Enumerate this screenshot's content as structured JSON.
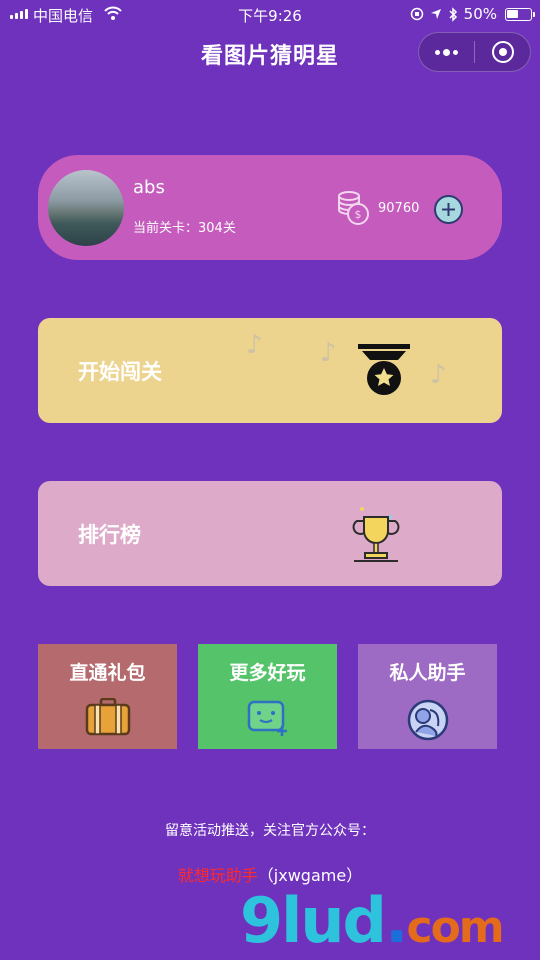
{
  "status_bar": {
    "carrier": "中国电信",
    "time": "下午9:26",
    "battery": "50%"
  },
  "header": {
    "title": "看图片猜明星"
  },
  "profile": {
    "username": "abs",
    "level": "当前关卡：304关",
    "coins": "90760"
  },
  "menu": {
    "start": "开始闯关",
    "rank": "排行榜",
    "tiles": [
      "直通礼包",
      "更多好玩",
      "私人助手"
    ]
  },
  "footer": {
    "notice": "留意活动推送，关注官方公众号：",
    "account_name": "就想玩助手",
    "account_id": "（jxwgame）"
  },
  "watermark": {
    "main": "9lud",
    "dot": ".",
    "com": "com"
  },
  "icons": {
    "status": [
      "signal-icon",
      "wifi-icon",
      "orientation-lock-icon",
      "location-icon",
      "bluetooth-icon",
      "battery-icon"
    ],
    "capsule": [
      "more-icon",
      "close-miniprogram-icon"
    ],
    "profile": [
      "coin-stack-icon",
      "add-icon"
    ],
    "menu": [
      "medal-icon",
      "trophy-icon",
      "music-note-icon",
      "suitcase-icon",
      "game-controller-icon",
      "helper-icon"
    ]
  },
  "colors": {
    "background": "#6f32bd",
    "profile_card": "#c45bbd",
    "start_button": "#ecd48f",
    "rank_button": "#ddabc9",
    "gift_tile": "#b56a6e",
    "more_tile": "#54c36a",
    "helper_tile": "#9d6ac4",
    "account_highlight": "#ff2a2a"
  }
}
